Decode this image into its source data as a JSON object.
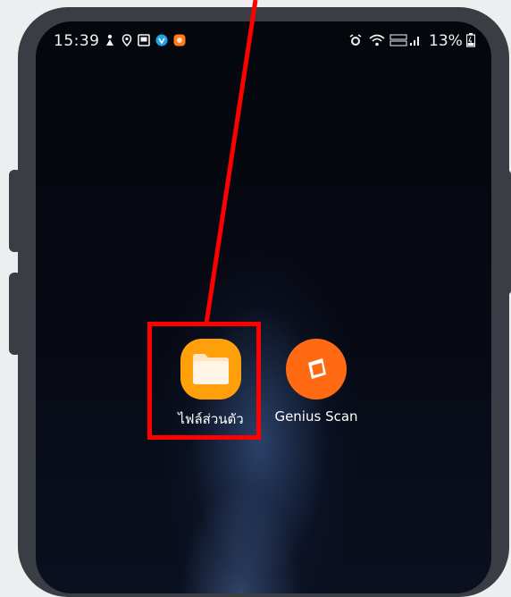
{
  "status_bar": {
    "time": "15:39",
    "battery_percent": "13%",
    "left_icons": [
      "fast-notification-icon",
      "location-pin-icon",
      "photo-icon",
      "blue-app-icon",
      "orange-app-icon"
    ],
    "right_icons": [
      "alarm-icon",
      "wifi-icon",
      "volte-lte-icon",
      "signal-bars-icon",
      "battery-charging-icon"
    ]
  },
  "home_screen": {
    "apps": [
      {
        "label": "ไฟล์ส่วนตัว",
        "icon": "folder-icon",
        "color": "#ff9f0a"
      },
      {
        "label": "Genius Scan",
        "icon": "genius-scan-icon",
        "color": "#ff6a13"
      }
    ]
  },
  "annotation": {
    "highlight_color": "#ff0000",
    "highlighted_app": "ไฟล์ส่วนตัว"
  }
}
